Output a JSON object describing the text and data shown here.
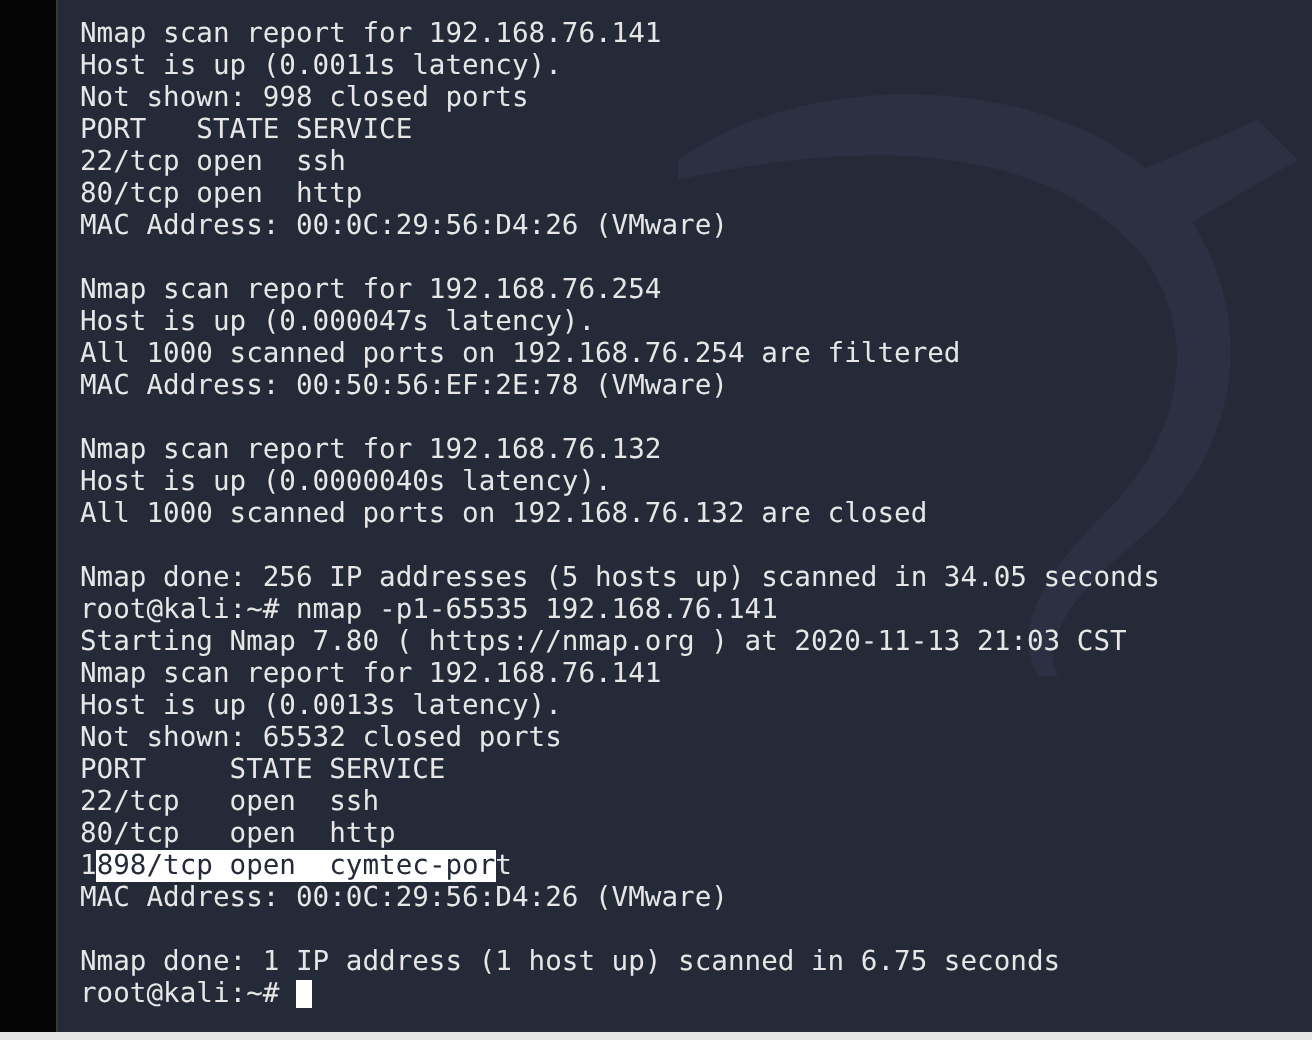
{
  "terminal": {
    "lines": [
      {
        "kind": "text",
        "text": "Nmap scan report for 192.168.76.141"
      },
      {
        "kind": "text",
        "text": "Host is up (0.0011s latency)."
      },
      {
        "kind": "text",
        "text": "Not shown: 998 closed ports"
      },
      {
        "kind": "text",
        "text": "PORT   STATE SERVICE"
      },
      {
        "kind": "text",
        "text": "22/tcp open  ssh"
      },
      {
        "kind": "text",
        "text": "80/tcp open  http"
      },
      {
        "kind": "text",
        "text": "MAC Address: 00:0C:29:56:D4:26 (VMware)"
      },
      {
        "kind": "blank"
      },
      {
        "kind": "text",
        "text": "Nmap scan report for 192.168.76.254"
      },
      {
        "kind": "text",
        "text": "Host is up (0.000047s latency)."
      },
      {
        "kind": "text",
        "text": "All 1000 scanned ports on 192.168.76.254 are filtered"
      },
      {
        "kind": "text",
        "text": "MAC Address: 00:50:56:EF:2E:78 (VMware)"
      },
      {
        "kind": "blank"
      },
      {
        "kind": "text",
        "text": "Nmap scan report for 192.168.76.132"
      },
      {
        "kind": "text",
        "text": "Host is up (0.0000040s latency)."
      },
      {
        "kind": "text",
        "text": "All 1000 scanned ports on 192.168.76.132 are closed"
      },
      {
        "kind": "blank"
      },
      {
        "kind": "text",
        "text": "Nmap done: 256 IP addresses (5 hosts up) scanned in 34.05 seconds"
      },
      {
        "kind": "text",
        "text": "root@kali:~# nmap -p1-65535 192.168.76.141"
      },
      {
        "kind": "text",
        "text": "Starting Nmap 7.80 ( https://nmap.org ) at 2020-11-13 21:03 CST"
      },
      {
        "kind": "text",
        "text": "Nmap scan report for 192.168.76.141"
      },
      {
        "kind": "text",
        "text": "Host is up (0.0013s latency)."
      },
      {
        "kind": "text",
        "text": "Not shown: 65532 closed ports"
      },
      {
        "kind": "text",
        "text": "PORT     STATE SERVICE"
      },
      {
        "kind": "text",
        "text": "22/tcp   open  ssh"
      },
      {
        "kind": "text",
        "text": "80/tcp   open  http"
      },
      {
        "kind": "segments",
        "segments": [
          {
            "text": "1",
            "selected": false
          },
          {
            "text": "898/tcp open  cymtec-por",
            "selected": true
          },
          {
            "text": "t",
            "selected": false
          }
        ]
      },
      {
        "kind": "text",
        "text": "MAC Address: 00:0C:29:56:D4:26 (VMware)"
      },
      {
        "kind": "blank"
      },
      {
        "kind": "text",
        "text": "Nmap done: 1 IP address (1 host up) scanned in 6.75 seconds"
      },
      {
        "kind": "prompt",
        "text": "root@kali:~#",
        "cursor": true
      }
    ]
  }
}
